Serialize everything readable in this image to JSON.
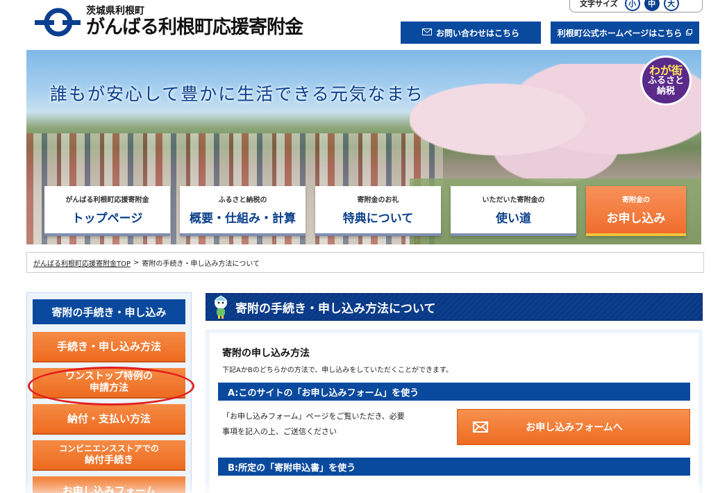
{
  "header": {
    "pref": "茨城県利根町",
    "title": "がんばる利根町応援寄附金",
    "font_size": {
      "label": "文字サイズ",
      "small": "小",
      "medium": "中",
      "large": "大",
      "active": "中"
    },
    "contact_label": "お問い合わせはこちら",
    "official_label": "利根町公式ホームページはこちら"
  },
  "hero": {
    "slogan": "誰もが安心して豊かに生活できる元気なまち",
    "badge": [
      "わが街",
      "ふるさと",
      "納税"
    ]
  },
  "nav": [
    {
      "small": "がんばる利根町応援寄附金",
      "big": "トップページ"
    },
    {
      "small": "ふるさと納税の",
      "big": "概要・仕組み・計算"
    },
    {
      "small": "寄附金のお礼",
      "big": "特典について"
    },
    {
      "small": "いただいた寄附金の",
      "big": "使い道"
    },
    {
      "small": "寄附金の",
      "big": "お申し込み"
    }
  ],
  "breadcrumb": {
    "home": "がんばる利根町応援寄附金TOP",
    "separator": ">",
    "current": "寄附の手続き・申し込み方法について"
  },
  "sidebar": {
    "title": "寄附の手続き・申し込み",
    "items": [
      {
        "line1": "手続き・申し込み方法",
        "line2": ""
      },
      {
        "line1": "ワンストップ特例の",
        "line2": "申請方法"
      },
      {
        "line1": "納付・支払い方法",
        "line2": ""
      },
      {
        "line1": "コンビニエンスストアでの",
        "line2": "納付手続き"
      },
      {
        "line1": "お申し込みフォーム",
        "line2": ""
      }
    ]
  },
  "main": {
    "heading": "寄附の手続き・申し込み方法について",
    "section_title": "寄附の申し込み方法",
    "section_desc": "下記AかBのどちらかの方法で、申し込みをしていただくことができます。",
    "method_a": {
      "title": "A:このサイトの「お申し込みフォーム」を使う",
      "text_line1": "「お申し込みフォーム」ページをご覧いただき、必要",
      "text_line2": "事項を記入の上、ご送信ください",
      "button": "お申し込みフォームへ"
    },
    "method_b": {
      "title": "B:所定の「寄附申込書」を使う"
    }
  },
  "colors": {
    "navy": "#0a4a9e",
    "orange": "#ee6b1f",
    "highlight_circle": "#e21e1e"
  }
}
